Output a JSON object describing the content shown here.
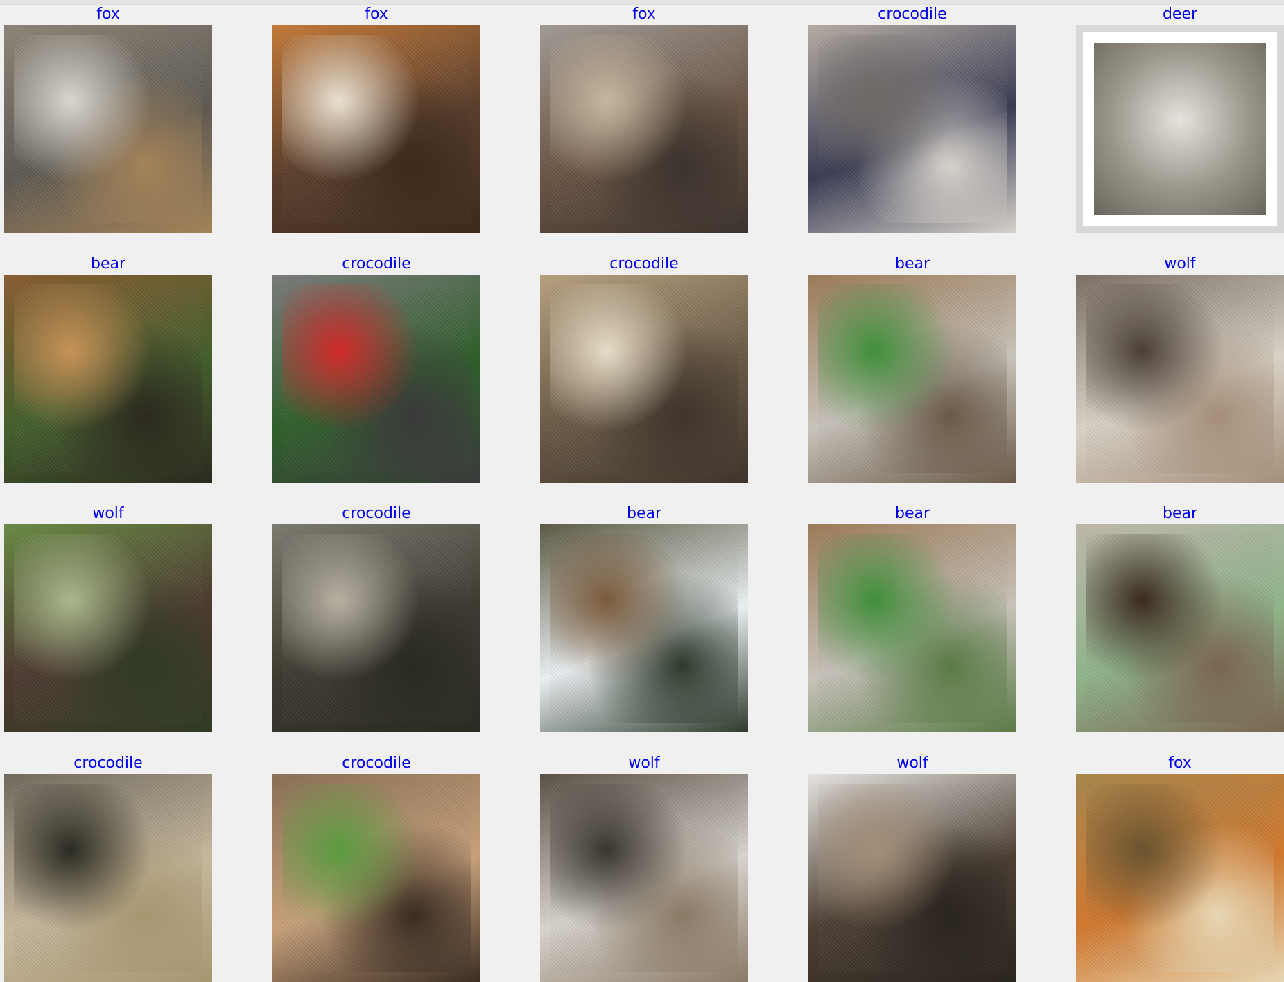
{
  "grid": {
    "cells": [
      {
        "label": "fox",
        "subject": "fox-photo",
        "palette": [
          "#8c8478",
          "#5e5a52",
          "#d9d6d0",
          "#a48358"
        ]
      },
      {
        "label": "fox",
        "subject": "fox-photo",
        "palette": [
          "#c27a3a",
          "#5a3e2c",
          "#e9e1d2",
          "#3c2a1c"
        ]
      },
      {
        "label": "fox",
        "subject": "fox-photo",
        "palette": [
          "#a09a94",
          "#6a5444",
          "#c7b79f",
          "#3b332d"
        ]
      },
      {
        "label": "crocodile",
        "subject": "crocodile-photo",
        "palette": [
          "#b5aca3",
          "#3a3c54",
          "#6f6a66",
          "#d6d1ca"
        ]
      },
      {
        "label": "deer",
        "subject": "deer-photo",
        "palette": [
          "#9a958a",
          "#6b665c",
          "#e6e3de",
          "#b28b66"
        ]
      },
      {
        "label": "bear",
        "subject": "bear-photo",
        "palette": [
          "#8a5d33",
          "#445f2c",
          "#c79258",
          "#2c2a1f"
        ]
      },
      {
        "label": "crocodile",
        "subject": "crocodile-photo",
        "palette": [
          "#7b7b7b",
          "#2f5f2b",
          "#d02a2a",
          "#3a3a3a"
        ]
      },
      {
        "label": "crocodile",
        "subject": "crocodile-photo",
        "palette": [
          "#b6a07f",
          "#6a5a46",
          "#e6dcc7",
          "#3f352c"
        ]
      },
      {
        "label": "bear",
        "subject": "bear-photo",
        "palette": [
          "#9c7a57",
          "#c7c2ba",
          "#3f8f3b",
          "#6a5a48"
        ]
      },
      {
        "label": "wolf",
        "subject": "wolf-photo",
        "palette": [
          "#7a6f65",
          "#d8d1c6",
          "#4a4038",
          "#a58f7a"
        ]
      },
      {
        "label": "wolf",
        "subject": "wolf-photo",
        "palette": [
          "#6a8a45",
          "#4c3a30",
          "#a9b68c",
          "#2f3a23"
        ]
      },
      {
        "label": "crocodile",
        "subject": "crocodile-photo",
        "palette": [
          "#7d7a70",
          "#3d3a30",
          "#b7b1a3",
          "#2a2a23"
        ]
      },
      {
        "label": "bear",
        "subject": "bear-photo",
        "palette": [
          "#5c5a44",
          "#e8eef0",
          "#7a5a3b",
          "#2f3a2d"
        ]
      },
      {
        "label": "bear",
        "subject": "bear-photo",
        "palette": [
          "#9c7a57",
          "#c7c2ba",
          "#3f8f3b",
          "#5a7a45"
        ]
      },
      {
        "label": "bear",
        "subject": "bear-photo",
        "palette": [
          "#bdb6aa",
          "#8fb48a",
          "#3a2a1e",
          "#7a6650"
        ]
      },
      {
        "label": "crocodile",
        "subject": "crocodile-photo",
        "palette": [
          "#6f6a5e",
          "#c6b79c",
          "#2b2b22",
          "#a69670"
        ]
      },
      {
        "label": "crocodile",
        "subject": "crocodile-photo",
        "palette": [
          "#8a6f55",
          "#c7a07a",
          "#5a9b3f",
          "#3a2c22"
        ]
      },
      {
        "label": "wolf",
        "subject": "wolf-photo",
        "palette": [
          "#5a5146",
          "#d7d2cc",
          "#3a352f",
          "#8a7a66"
        ]
      },
      {
        "label": "wolf",
        "subject": "wolf-photo",
        "palette": [
          "#e6e3df",
          "#4c4034",
          "#a38e78",
          "#2a241f"
        ]
      },
      {
        "label": "fox",
        "subject": "fox-photo",
        "palette": [
          "#a6864d",
          "#d0782e",
          "#6a5430",
          "#e6d6b3"
        ]
      }
    ]
  }
}
